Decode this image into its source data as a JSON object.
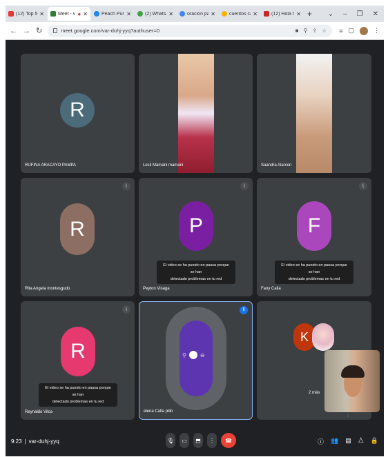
{
  "tabs": [
    {
      "label": "(12) Top 5 la M",
      "color": "#e53935"
    },
    {
      "label": "Meet - var-",
      "color": "#2e7d32",
      "active": true
    },
    {
      "label": "Peach Purple ro",
      "color": "#1e88e5"
    },
    {
      "label": "(2) WhatsApp",
      "color": "#43a047"
    },
    {
      "label": "oracion para n",
      "color": "#4285f4"
    },
    {
      "label": "cuentos catolic",
      "color": "#f4b400"
    },
    {
      "label": "(12) Hola hola",
      "color": "#c62828"
    }
  ],
  "address": {
    "url": "meet.google.com/var-duhj-yyq?authuser=0"
  },
  "participants": [
    {
      "name": "RUFINA ARACAYO PAMPA",
      "initial": "R",
      "color": "#4b6a7a"
    },
    {
      "name": "Lesli Mamani mamani",
      "initial": "",
      "color": ""
    },
    {
      "name": "Saandra Alarcon",
      "initial": "",
      "color": ""
    },
    {
      "name": "Rita Angela montesgudo",
      "initial": "R",
      "color": "#8d6e63"
    },
    {
      "name": "Peyton Visaga",
      "initial": "P",
      "color": "#7b1fa2"
    },
    {
      "name": "Fany Calla",
      "initial": "F",
      "color": "#ab47bc"
    },
    {
      "name": "Reynaldo Vilca",
      "initial": "R",
      "color": "#e53970"
    },
    {
      "name": "elena Calla pillo",
      "initial": "",
      "color": "#5e35b1"
    },
    {
      "name": "2 más",
      "initial": "K",
      "color": "#bf360c"
    }
  ],
  "notice": {
    "line1": "El video se ha puesto en pausa porque se han",
    "line2": "detectado problemas en tu red"
  },
  "bottom": {
    "time": "9:23",
    "meeting_code": "var-duhj-yyq"
  }
}
